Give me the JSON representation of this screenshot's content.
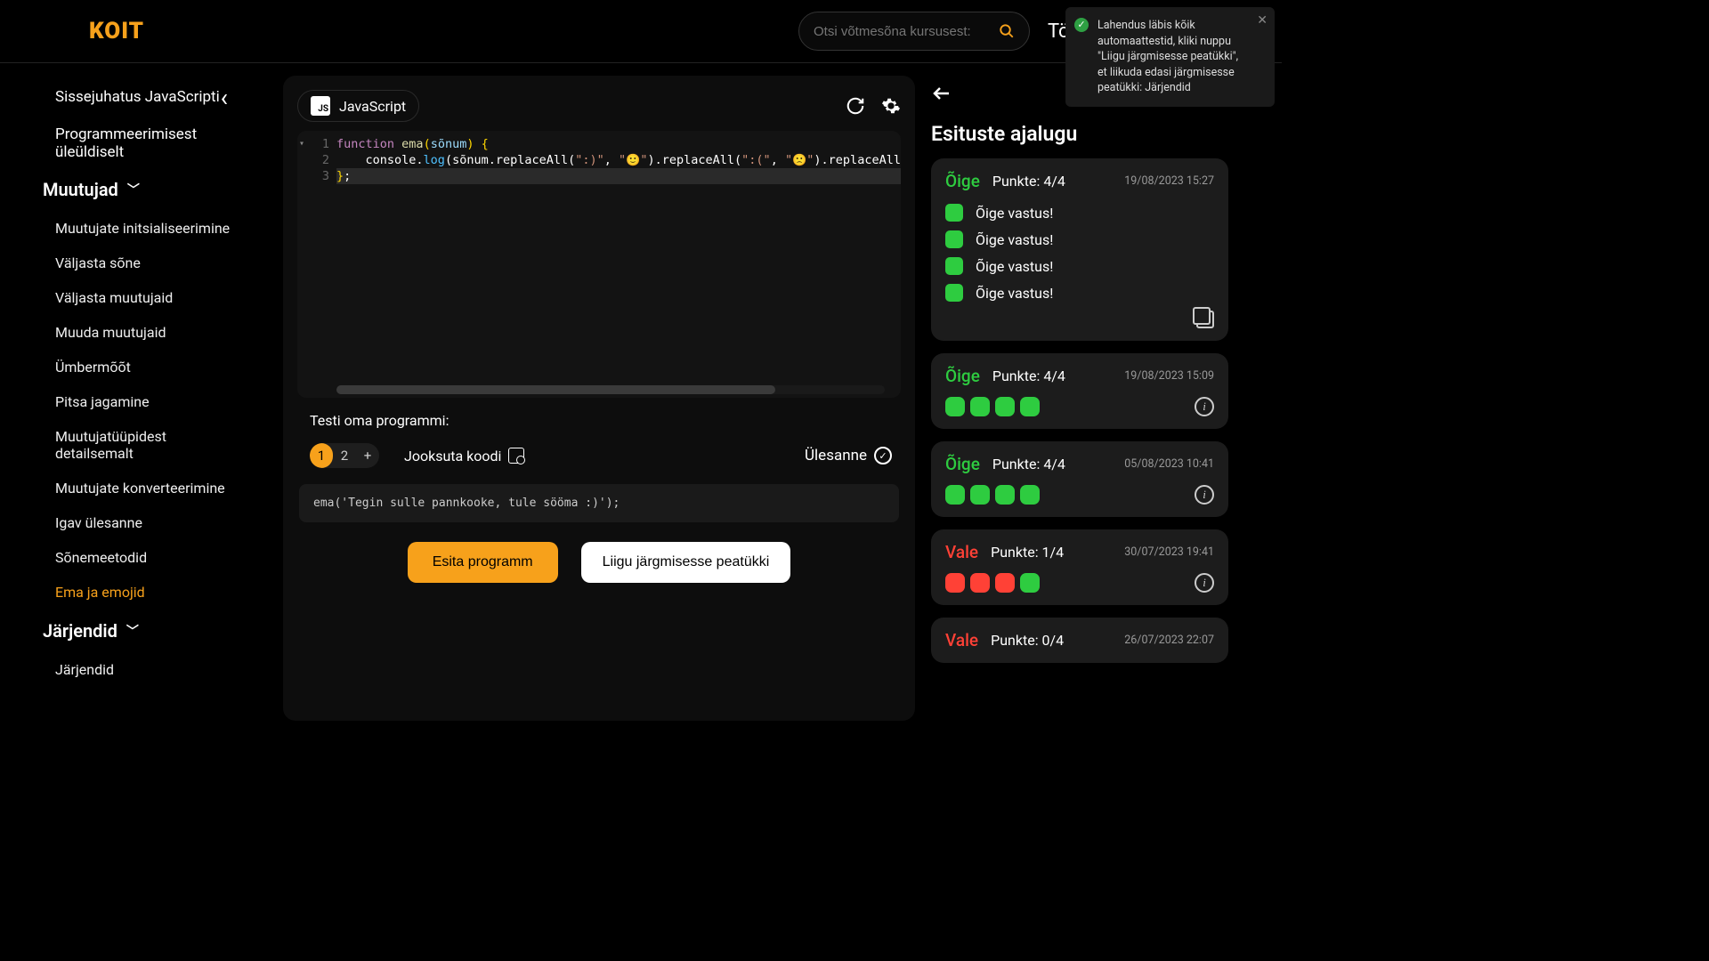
{
  "brand": "KOIT",
  "header": {
    "search_placeholder": "Otsi võtmesõna kursusest:",
    "dashboard": "Töölaud"
  },
  "toast": {
    "text": "Lahendus läbis kõik automaattestid, kliki nuppu \"Liigu järgmisesse peatükki\", et liikuda edasi järgmisesse peatükki: Järjendid"
  },
  "sidebar": {
    "course": "Sissejuhatus JavaScripti",
    "intro": "Programmeerimisest üleüldiselt",
    "section_vars": "Muutujad",
    "items": [
      "Muutujate initsialiseerimine",
      "Väljasta sõne",
      "Väljasta muutujaid",
      "Muuda muutujaid",
      "Ümbermõõt",
      "Pitsa jagamine",
      "Muutujatüüpidest detailsemalt",
      "Muutujate konverteerimine",
      "Igav ülesanne",
      "Sõnemeetodid",
      "Ema ja emojid"
    ],
    "active_index": 10,
    "section_arrays": "Järjendid",
    "array_items": [
      "Järjendid"
    ]
  },
  "editor": {
    "language": "JavaScript",
    "code_lines": [
      {
        "n": "1",
        "html": "<span class='kw'>function</span> <span class='fn'>ema</span><span class='paren'>(</span><span class='var'>sõnum</span><span class='paren'>)</span> <span class='paren'>{</span>"
      },
      {
        "n": "2",
        "html": "    console.<span class='mthd'>log</span>(sõnum.replaceAll(<span class='str'>\":)\"</span>, <span class='str'>\"<span class='emoji'>🙂</span>\"</span>).replaceAll(<span class='str'>\":(\"</span>, <span class='str'>\"<span class='emoji'>🙁</span>\"</span>).replaceAll("
      },
      {
        "n": "3",
        "html": "<span class='paren'>}</span>;"
      }
    ],
    "test_label": "Testi oma programmi:",
    "tabs": [
      "1",
      "2",
      "+"
    ],
    "active_tab": 0,
    "run_label": "Jooksuta koodi",
    "task_label": "Ülesanne",
    "test_call": "ema('Tegin sulle pannkooke, tule sööma :)');",
    "submit": "Esita programm",
    "next": "Liigu järgmisesse peatükki"
  },
  "history": {
    "title": "Esituste ajalugu",
    "points_prefix": "Punkte: ",
    "correct_label": "Õige",
    "wrong_label": "Vale",
    "answer_ok": "Õige vastus!",
    "cards": [
      {
        "status": "correct",
        "points": "4/4",
        "date": "19/08/2023 15:27",
        "expanded": true,
        "answers": [
          "ok",
          "ok",
          "ok",
          "ok"
        ]
      },
      {
        "status": "correct",
        "points": "4/4",
        "date": "19/08/2023 15:09",
        "dots": [
          "g",
          "g",
          "g",
          "g"
        ]
      },
      {
        "status": "correct",
        "points": "4/4",
        "date": "05/08/2023 10:41",
        "dots": [
          "g",
          "g",
          "g",
          "g"
        ]
      },
      {
        "status": "wrong",
        "points": "1/4",
        "date": "30/07/2023 19:41",
        "dots": [
          "r",
          "r",
          "r",
          "g"
        ]
      },
      {
        "status": "wrong",
        "points": "0/4",
        "date": "26/07/2023 22:07",
        "dots": []
      }
    ]
  }
}
